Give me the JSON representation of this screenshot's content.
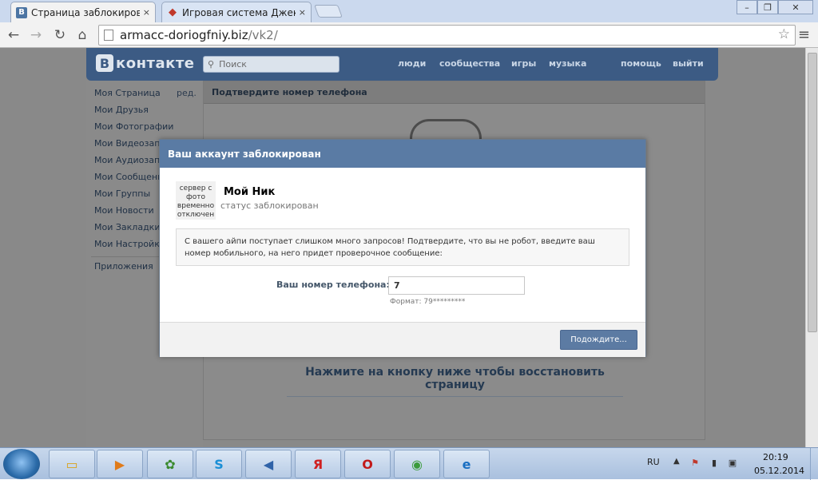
{
  "browser": {
    "tabs": [
      {
        "label": "Страница заблокирована",
        "favicon": "В",
        "close": "×",
        "active": true
      },
      {
        "label": "Игровая система Джекпот",
        "favicon": "◆",
        "close": "×",
        "active": false
      }
    ],
    "url_host": "armacc-doriogfniy.biz",
    "url_path": "/vk2/",
    "window_controls": {
      "minimize": "–",
      "maximize": "❐",
      "close": "✕"
    }
  },
  "vk": {
    "logo_letter": "В",
    "logo_word": "контакте",
    "search_placeholder": "Поиск",
    "nav": [
      "люди",
      "сообщества",
      "игры",
      "музыка",
      "помощь",
      "выйти"
    ],
    "left_menu": [
      "Моя Страница",
      "Мои Друзья",
      "Мои Фотографии",
      "Мои Видеозаписи",
      "Мои Аудиозаписи",
      "Мои Сообщения",
      "Мои Группы",
      "Мои Новости",
      "Мои Закладки",
      "Мои Настройки"
    ],
    "left_menu_edit": "ред.",
    "left_menu_apps": "Приложения",
    "content_title": "Подтвердите номер телефона",
    "restore_text": "Нажмите на кнопку ниже чтобы восстановить страницу"
  },
  "modal": {
    "title": "Ваш аккаунт заблокирован",
    "avatar_text": "сервер с фото временно отключен",
    "nick": "Мой Ник",
    "status": "статус заблокирован",
    "notice": "С вашего айпи поступает слишком много запросов! Подтвердите, что вы не робот, введите ваш номер мобильного, на него придет проверочное сообщение:",
    "phone_label": "Ваш номер телефона:",
    "phone_value": "7",
    "phone_format": "Формат: 79*********",
    "button": "Подождите..."
  },
  "taskbar": {
    "lang": "RU",
    "time": "20:19",
    "date": "05.12.2014"
  },
  "colors": {
    "vk_blue": "#5a7ba4",
    "vk_header": "#3c5b84",
    "overlay_gray": "#898989"
  }
}
